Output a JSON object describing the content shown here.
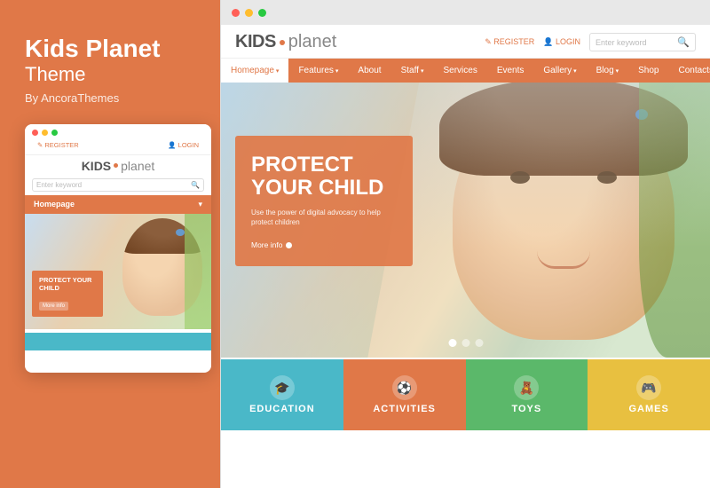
{
  "left": {
    "title1": "Kids Planet",
    "subtitle": "Theme",
    "by": "By AncoraThemes"
  },
  "mobile": {
    "register": "REGISTER",
    "login": "LOGIN",
    "logo_kids": "KIDS",
    "logo_planet": "planet",
    "search_placeholder": "Enter keyword",
    "menu_label": "Homepage",
    "hero_title": "PROTECT YOUR CHILD",
    "hero_btn": "More info"
  },
  "desktop": {
    "register": "REGISTER",
    "login": "LOGIN",
    "logo_kids": "KIDS",
    "logo_planet": "planet",
    "search_placeholder": "Enter keyword",
    "nav": {
      "homepage": "Homepage",
      "features": "Features",
      "about": "About",
      "staff": "Staff",
      "services": "Services",
      "events": "Events",
      "gallery": "Gallery",
      "blog": "Blog",
      "shop": "Shop",
      "contacts": "Contacts"
    },
    "hero": {
      "title": "PROTECT YOUR CHILD",
      "subtitle": "Use the power of digital advocacy to help protect children",
      "btn": "More info"
    },
    "cards": {
      "education": "EDUCATION",
      "activities": "ACTIVITIES",
      "toys": "TOYS",
      "games": "GAMES"
    }
  },
  "icons": {
    "dots": "···",
    "search": "🔍",
    "arrow_down": "▾",
    "register_icon": "✎",
    "login_icon": "👤"
  }
}
